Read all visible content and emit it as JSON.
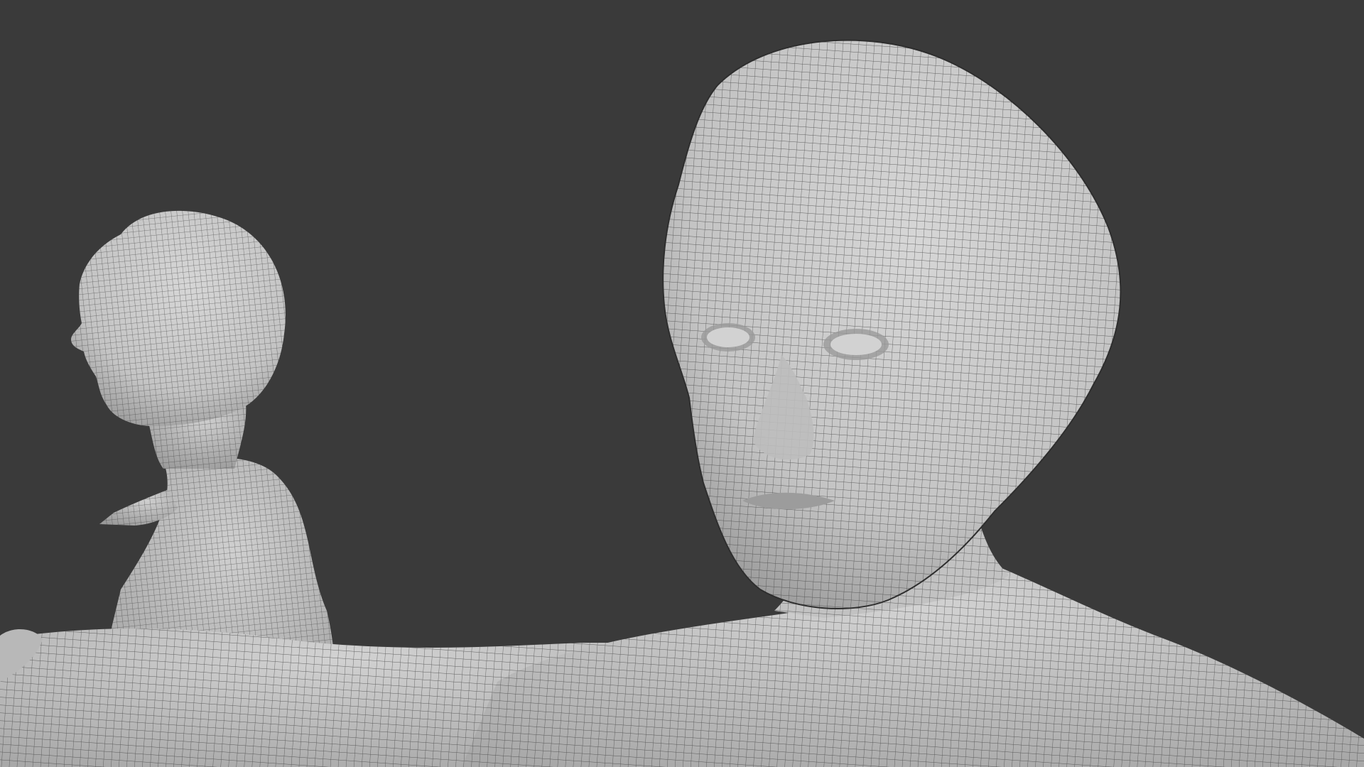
{
  "viewport": {
    "background_color": "#3a3a3a"
  },
  "models": [
    {
      "name": "background-figure",
      "view": "side-profile",
      "mesh_color": "#c9c9c9",
      "wire_color": "#3c3c3c"
    },
    {
      "name": "foreground-figure",
      "view": "three-quarter-front",
      "mesh_color": "#cfcfcf",
      "wire_color": "#3c3c3c"
    }
  ]
}
